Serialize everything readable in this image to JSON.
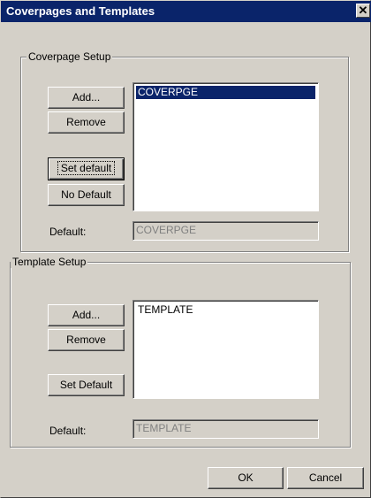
{
  "window": {
    "title": "Coverpages and Templates",
    "close_glyph": "✕"
  },
  "coverpage_setup": {
    "group_label": "Coverpage Setup",
    "add_label": "Add...",
    "remove_label": "Remove",
    "set_default_label": "Set default",
    "no_default_label": "No Default",
    "default_label": "Default:",
    "default_value": "COVERPGE",
    "items": [
      {
        "label": "COVERPGE",
        "selected": true
      }
    ]
  },
  "template_setup": {
    "group_label": "Template Setup",
    "add_label": "Add...",
    "remove_label": "Remove",
    "set_default_label": "Set Default",
    "default_label": "Default:",
    "default_value": "TEMPLATE",
    "items": [
      {
        "label": "TEMPLATE",
        "selected": false
      }
    ]
  },
  "footer": {
    "ok_label": "OK",
    "cancel_label": "Cancel"
  },
  "colors": {
    "titlebar": "#0a246a",
    "face": "#d4d0c8",
    "selection": "#0a246a"
  }
}
